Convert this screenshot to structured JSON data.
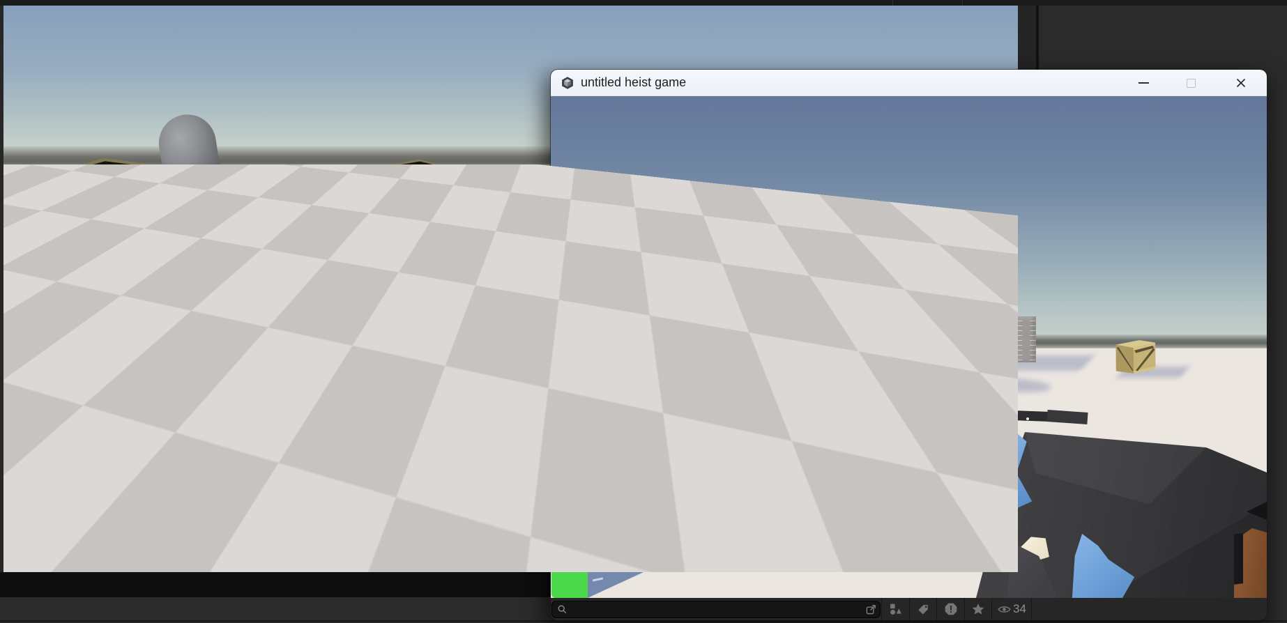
{
  "window": {
    "title": "untitled heist game",
    "title_icon": "unity-cube-icon",
    "controls": {
      "minimize": "minimize",
      "maximize": "maximize",
      "close": "close"
    },
    "toolbar": {
      "search": {
        "value": "",
        "placeholder": ""
      },
      "icons": [
        "search",
        "open-in-new-window",
        "filter-by-type",
        "filter-by-tag",
        "filter-warnings",
        "filter-favorites",
        "visibility"
      ],
      "visibility_count": "34"
    }
  },
  "editor_viewport": {
    "hud": {
      "health_bar": "green-bar"
    },
    "scene_objects": [
      "wooden-crate",
      "capsule-character",
      "wooden-crate",
      "checker-floor"
    ],
    "crosshair": "dot"
  },
  "window_viewport": {
    "hud": {
      "health_bar": "green-bar"
    },
    "scene_objects": [
      "wooden-crate",
      "capsule-character",
      "brick-wall",
      "wooden-crate",
      "ak-rifle-first-person"
    ],
    "crosshair": "ring-dot"
  },
  "colors": {
    "editor_bg": "#2b2b2b",
    "topbar": "#1a1a1a",
    "letterbox": "#0e0e0e",
    "titlebar_bg": "#edf1f8",
    "titlebar_text": "#1e1e1e",
    "toolbar_bg": "#262626",
    "search_bg": "#151515",
    "icon_gray": "#757575",
    "count_text": "#8f8f8f",
    "health_green": "#4bd84b",
    "sky_left_top": "#87a0bc",
    "sky_window_top": "#64779b",
    "floor_window": "#ece6e1",
    "shadow_blue": "#7489ad",
    "stock_brown": "#8a5732"
  }
}
